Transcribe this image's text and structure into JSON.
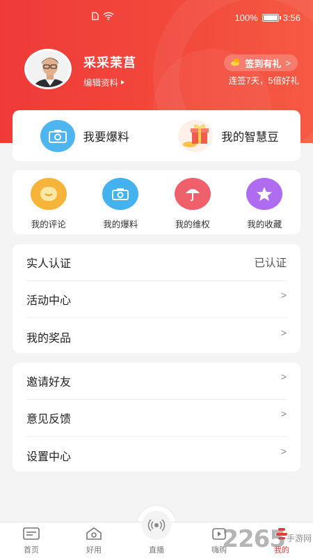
{
  "status_bar": {
    "battery": "100%",
    "time": "3:56"
  },
  "profile": {
    "username": "采采苿莒",
    "edit_label": "编辑资料",
    "signin_label": "签到有礼",
    "signin_chevron": ">",
    "signin_subtitle": "连签7天，5倍好礼"
  },
  "quick_actions": [
    {
      "label": "我要爆料",
      "icon": "camera-icon"
    },
    {
      "label": "我的智慧豆",
      "icon": "gift-box-icon"
    }
  ],
  "shortcuts": [
    {
      "label": "我的评论",
      "icon": "smile-icon",
      "color": "#f7b43a"
    },
    {
      "label": "我的爆料",
      "icon": "camera-icon",
      "color": "#43b2ee"
    },
    {
      "label": "我的维权",
      "icon": "umbrella-icon",
      "color": "#f0606a"
    },
    {
      "label": "我的收藏",
      "icon": "star-icon",
      "color": "#b06cf0"
    }
  ],
  "menu_group_1": [
    {
      "label": "实人认证",
      "value": "已认证"
    },
    {
      "label": "活动中心",
      "arrow": ">"
    },
    {
      "label": "我的奖品",
      "arrow": ">"
    }
  ],
  "menu_group_2": [
    {
      "label": "邀请好友",
      "arrow": ">"
    },
    {
      "label": "意见反馈",
      "arrow": ">"
    },
    {
      "label": "设置中心",
      "arrow": ">"
    }
  ],
  "tabbar": [
    {
      "label": "首页",
      "icon": "news-icon"
    },
    {
      "label": "好用",
      "icon": "house-icon"
    },
    {
      "label": "直播",
      "icon": "broadcast-icon"
    },
    {
      "label": "嗨购",
      "icon": "play-bag-icon"
    },
    {
      "label": "我的",
      "icon": "person-icon"
    }
  ],
  "watermark": {
    "number": "2265",
    "side_top": "手游网",
    "side_bottom": ""
  },
  "colors": {
    "brand_red": "#f03a38",
    "active_tab": "#e83a3a"
  }
}
